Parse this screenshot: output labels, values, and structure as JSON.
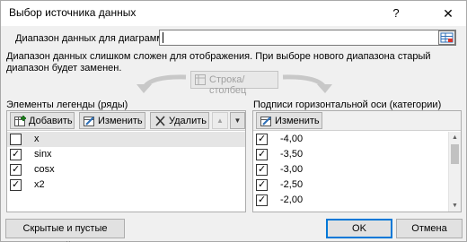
{
  "dialog": {
    "title": "Выбор источника данных",
    "help": "?",
    "close": "✕"
  },
  "range": {
    "label": "Диапазон данных для диаграммы:",
    "value": ""
  },
  "warning": "Диапазон данных слишком сложен для отображения. При выборе нового диапазона старый диапазон будет заменен.",
  "switch_button": "Строка/столбец",
  "legend": {
    "title": "Элементы легенды (ряды)",
    "add": "Добавить",
    "edit": "Изменить",
    "delete": "Удалить",
    "up": "▲",
    "down": "▼",
    "items": [
      {
        "label": "x",
        "checked": false,
        "selected": true
      },
      {
        "label": "sinx",
        "checked": true,
        "selected": false
      },
      {
        "label": "cosx",
        "checked": true,
        "selected": false
      },
      {
        "label": "x2",
        "checked": true,
        "selected": false
      }
    ]
  },
  "axis": {
    "title": "Подписи горизонтальной оси (категории)",
    "edit": "Изменить",
    "items": [
      {
        "label": "-4,00",
        "checked": true
      },
      {
        "label": "-3,50",
        "checked": true
      },
      {
        "label": "-3,00",
        "checked": true
      },
      {
        "label": "-2,50",
        "checked": true
      },
      {
        "label": "-2,00",
        "checked": true
      }
    ]
  },
  "buttons": {
    "hidden_cells": "Скрытые и пустые ячейки",
    "ok": "OK",
    "cancel": "Отмена"
  },
  "icons": {
    "check": "✓",
    "scroll_up": "▲",
    "scroll_down": "▼"
  }
}
